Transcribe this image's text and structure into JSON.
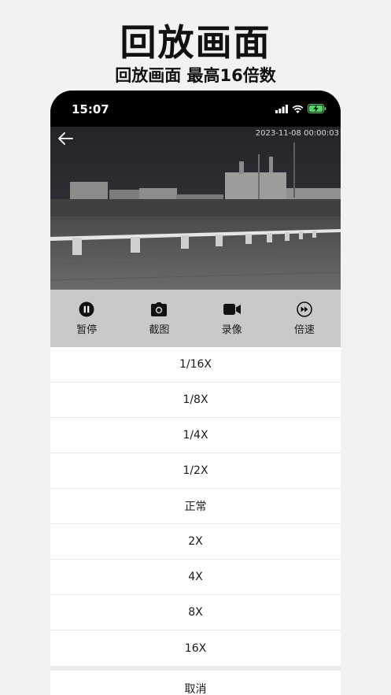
{
  "promo": {
    "title": "回放画面",
    "subtitle": "回放画面 最高16倍数"
  },
  "status_bar": {
    "time": "15:07",
    "icons": [
      "signal-icon",
      "wifi-icon",
      "battery-charging-icon"
    ],
    "battery_color": "#4cd964"
  },
  "video": {
    "timestamp": "2023-11-08 00:00:03",
    "back_icon": "arrow-left-icon"
  },
  "controls": [
    {
      "label": "暂停",
      "icon": "pause-icon"
    },
    {
      "label": "截图",
      "icon": "camera-icon"
    },
    {
      "label": "录像",
      "icon": "video-camera-icon"
    },
    {
      "label": "倍速",
      "icon": "fast-forward-icon"
    }
  ],
  "speed_options": [
    "1/16X",
    "1/8X",
    "1/4X",
    "1/2X",
    "正常",
    "2X",
    "4X",
    "8X",
    "16X"
  ],
  "cancel_label": "取消"
}
